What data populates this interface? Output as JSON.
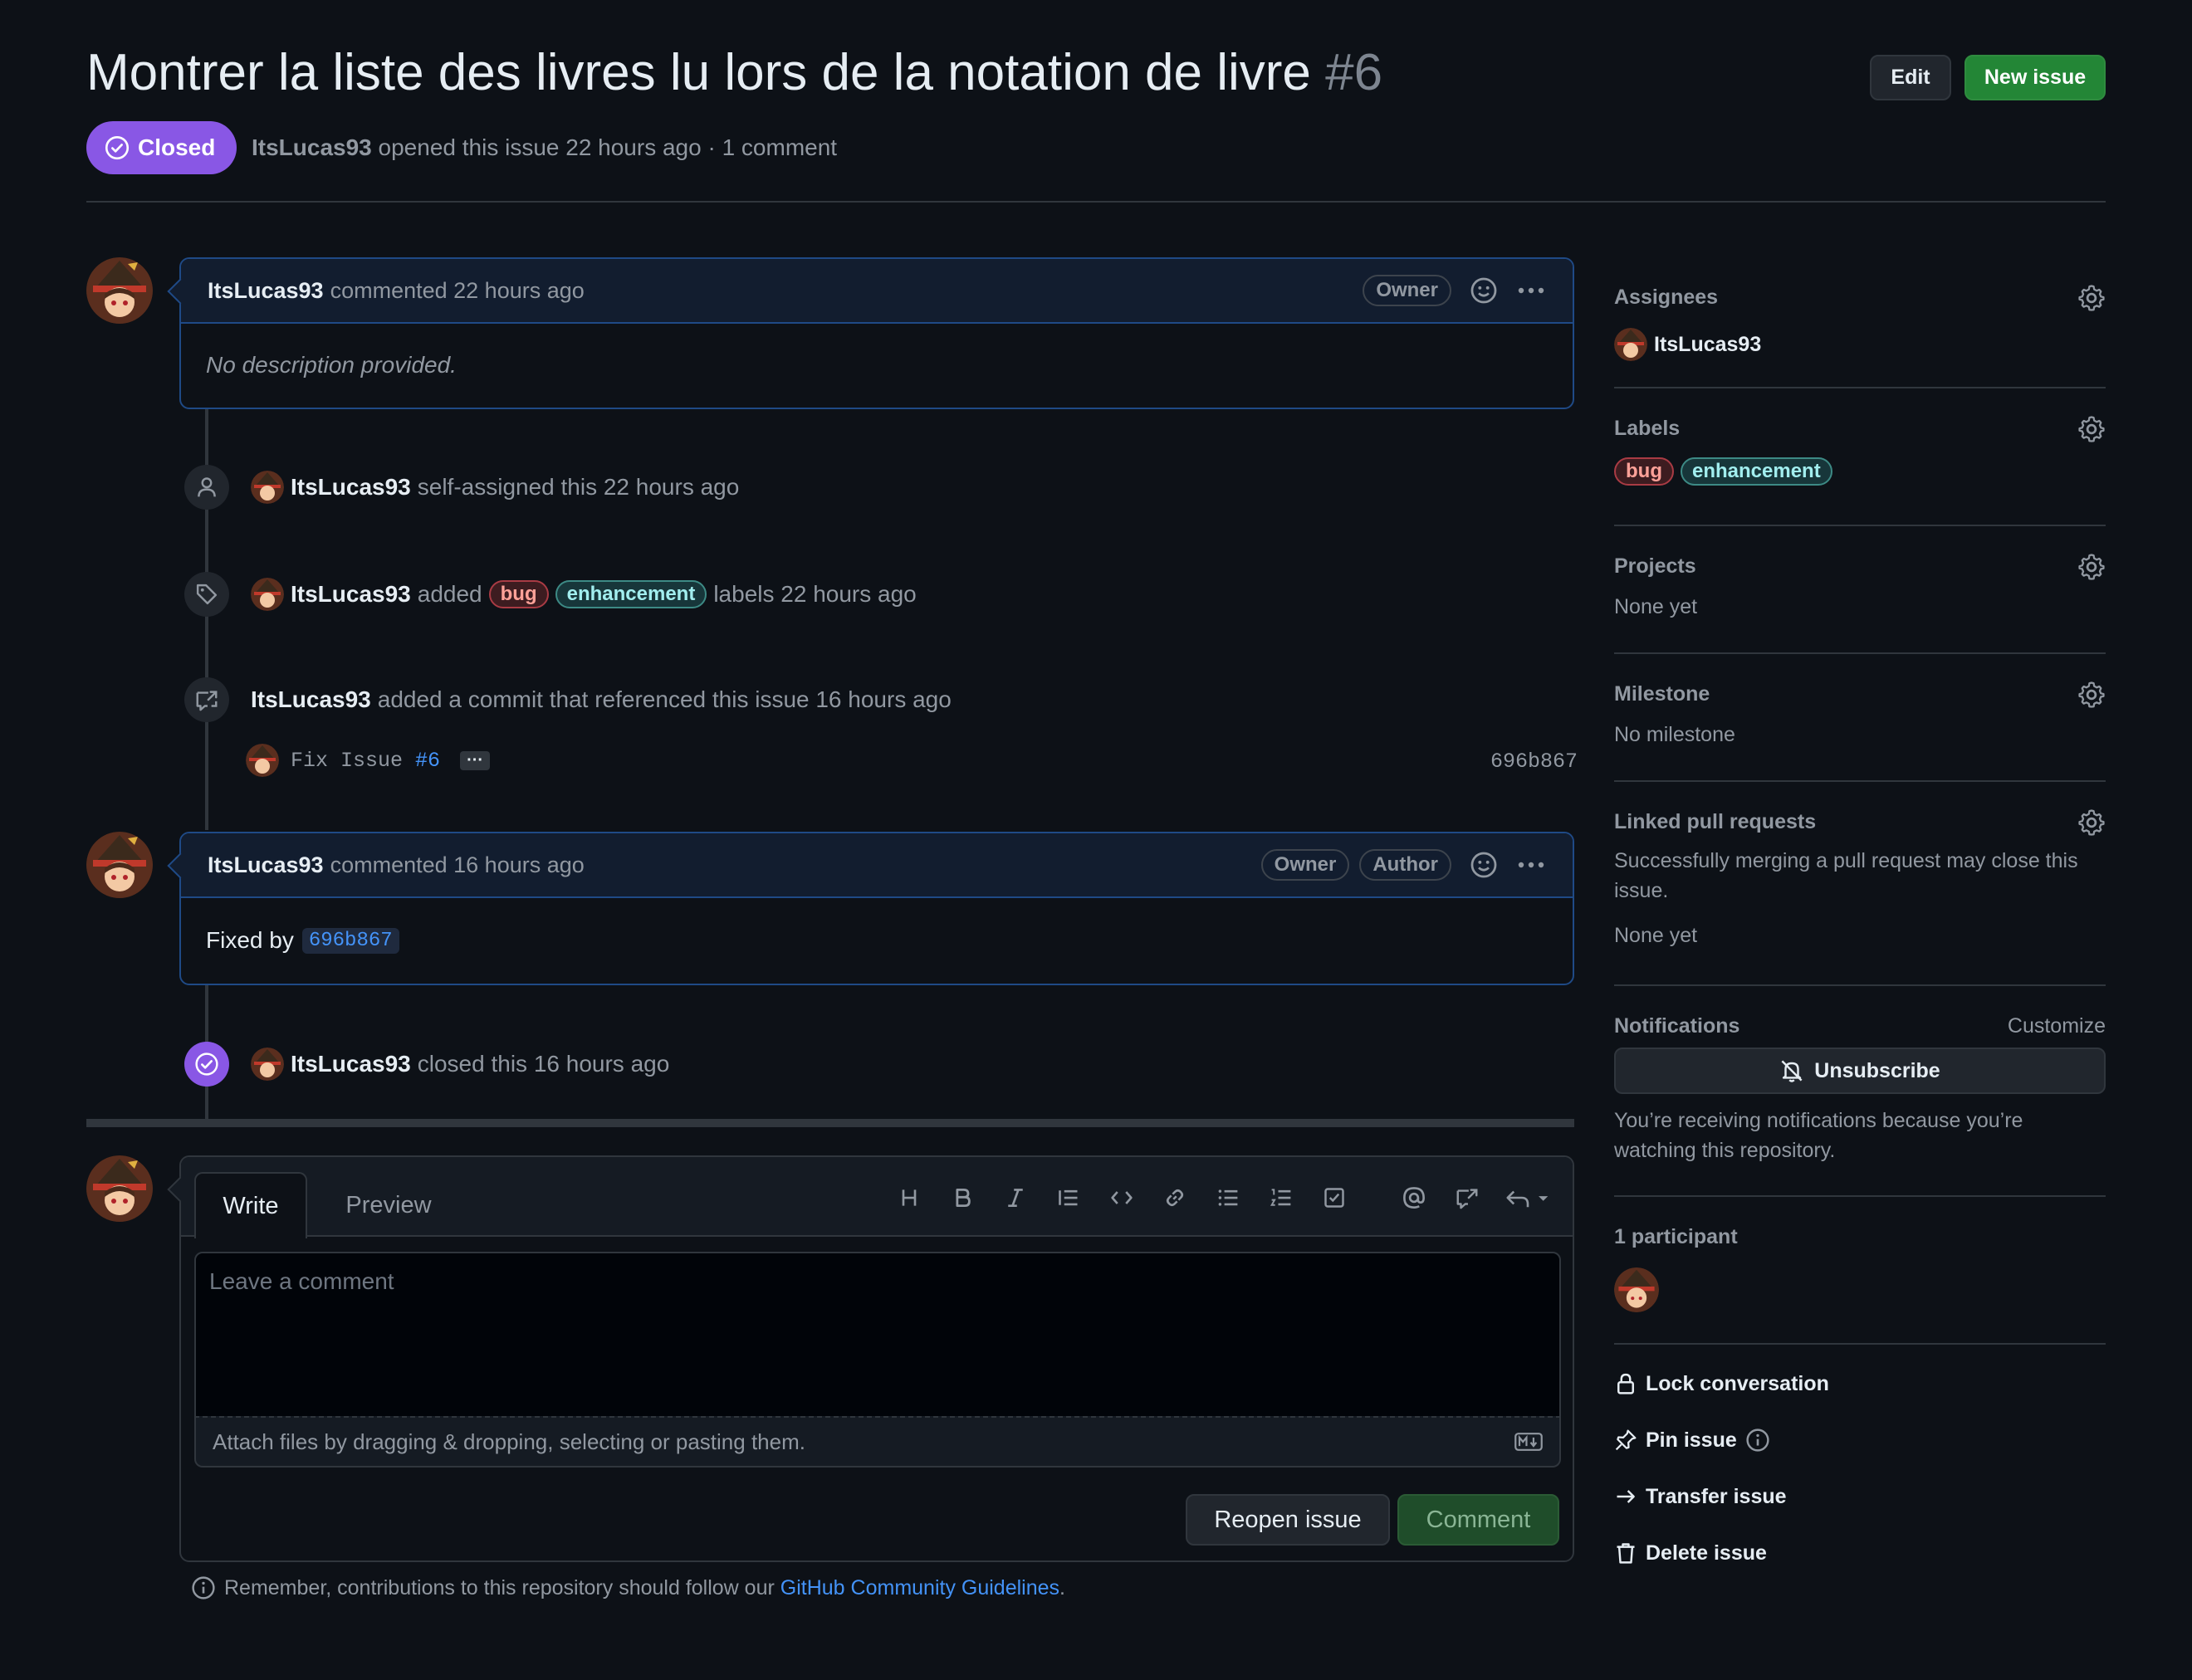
{
  "issue": {
    "title": "Montrer la liste des livres lu lors de la notation de livre",
    "number": "#6",
    "state": "Closed",
    "author": "ItsLucas93",
    "opened_text": "opened this issue 22 hours ago · 1 comment"
  },
  "header_buttons": {
    "edit": "Edit",
    "new_issue": "New issue"
  },
  "comments": [
    {
      "author": "ItsLucas93",
      "when": "commented 22 hours ago",
      "badges": [
        "Owner"
      ],
      "body": "No description provided."
    },
    {
      "author": "ItsLucas93",
      "when": "commented 16 hours ago",
      "badges": [
        "Owner",
        "Author"
      ],
      "body_prefix": "Fixed by",
      "body_link": "696b867"
    }
  ],
  "events": {
    "assigned": {
      "actor": "ItsLucas93",
      "text": "self-assigned this 22 hours ago"
    },
    "labeled": {
      "actor": "ItsLucas93",
      "verb": "added",
      "labels": [
        "bug",
        "enhancement"
      ],
      "suffix": "labels 22 hours ago"
    },
    "referenced": {
      "actor": "ItsLucas93",
      "text": "added a commit that referenced this issue 16 hours ago",
      "commit_message": "Fix Issue",
      "commit_ref": "#6",
      "ellipsis": "···",
      "sha": "696b867"
    },
    "closed": {
      "actor": "ItsLucas93",
      "text": "closed this 16 hours ago"
    }
  },
  "composer": {
    "tabs": [
      "Write",
      "Preview"
    ],
    "placeholder": "Leave a comment",
    "attach_text": "Attach files by dragging & dropping, selecting or pasting them.",
    "reopen_button": "Reopen issue",
    "comment_button": "Comment",
    "guidelines_prefix": "Remember, contributions to this repository should follow our",
    "guidelines_link": "GitHub Community Guidelines",
    "guidelines_suffix": "."
  },
  "toolbar_icons": [
    "heading-icon",
    "bold-icon",
    "italic-icon",
    "quote-icon",
    "code-icon",
    "link-icon",
    "unordered-list-icon",
    "ordered-list-icon",
    "task-list-icon",
    "mention-icon",
    "cross-reference-icon",
    "reply-icon"
  ],
  "sidebar": {
    "assignees": {
      "title": "Assignees",
      "value": "ItsLucas93"
    },
    "labels": {
      "title": "Labels",
      "values": [
        "bug",
        "enhancement"
      ]
    },
    "projects": {
      "title": "Projects",
      "value": "None yet"
    },
    "milestone": {
      "title": "Milestone",
      "value": "No milestone"
    },
    "linked_prs": {
      "title": "Linked pull requests",
      "description": "Successfully merging a pull request may close this issue.",
      "value": "None yet"
    },
    "notifications": {
      "title": "Notifications",
      "customize": "Customize",
      "button": "Unsubscribe",
      "note": "You’re receiving notifications because you’re watching this repository."
    },
    "participants": {
      "title": "1 participant"
    },
    "actions": {
      "lock": "Lock conversation",
      "pin": "Pin issue",
      "transfer": "Transfer issue",
      "delete": "Delete issue"
    }
  },
  "colors": {
    "background": "#0d1117",
    "closed_purple": "#8957e5",
    "new_issue_green": "#238636",
    "link_blue": "#4493f8",
    "comment_border": "#1f4a86"
  }
}
